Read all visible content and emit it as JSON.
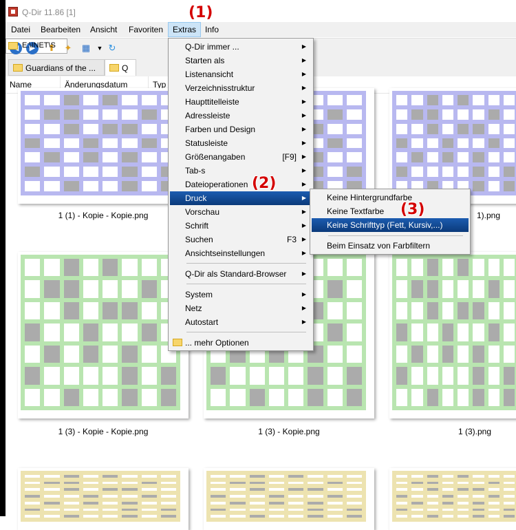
{
  "window": {
    "title": "Q-Dir 11.86 [1]"
  },
  "menubar": {
    "items": [
      "Datei",
      "Bearbeiten",
      "Ansicht",
      "Favoriten",
      "Extras",
      "Info"
    ]
  },
  "address": {
    "value": "E:\\INET\\S"
  },
  "tabs": [
    {
      "label": "Guardians of the ..."
    },
    {
      "label": "Q"
    }
  ],
  "columns": [
    "Name",
    "Änderungsdatum",
    "Typ"
  ],
  "thumbnails": [
    {
      "caption": "1 (1) - Kopie - Kopie.png",
      "color": "#b8b8f0"
    },
    {
      "caption": "1).png",
      "color": "#b8b8f0"
    },
    {
      "caption": "1 (3) - Kopie - Kopie.png",
      "color": "#b9e5b0"
    },
    {
      "caption": "1 (3) - Kopie.png",
      "color": "#b9e5b0"
    },
    {
      "caption": "1 (3).png",
      "color": "#b9e5b0"
    },
    {
      "caption": "",
      "color": "#ede3b0"
    }
  ],
  "extras_menu": {
    "items": [
      {
        "label": "Q-Dir immer ...",
        "submenu": true
      },
      {
        "label": "Starten als",
        "submenu": true
      },
      {
        "label": "Listenansicht",
        "submenu": true
      },
      {
        "label": "Verzeichnisstruktur",
        "submenu": true
      },
      {
        "label": "Haupttitelleiste",
        "submenu": true
      },
      {
        "label": "Adressleiste",
        "submenu": true
      },
      {
        "label": "Farben und Design",
        "submenu": true
      },
      {
        "label": "Statusleiste",
        "submenu": true
      },
      {
        "label": "Größenangaben",
        "shortcut": "[F9]",
        "submenu": true
      },
      {
        "label": "Tab-s",
        "submenu": true
      },
      {
        "label": "Dateioperationen",
        "submenu": true
      },
      {
        "label": "Druck",
        "submenu": true,
        "highlighted": true
      },
      {
        "label": "Vorschau",
        "submenu": true
      },
      {
        "label": "Schrift",
        "submenu": true
      },
      {
        "label": "Suchen",
        "shortcut": "F3",
        "submenu": true
      },
      {
        "label": "Ansichtseinstellungen",
        "submenu": true
      },
      {
        "label": "Q-Dir als Standard-Browser",
        "submenu": true
      },
      {
        "label": "System",
        "submenu": true
      },
      {
        "label": "Netz",
        "submenu": true
      },
      {
        "label": "Autostart",
        "submenu": true
      },
      {
        "label": "... mehr Optionen",
        "submenu": false
      }
    ]
  },
  "druck_submenu": {
    "items": [
      {
        "label": "Keine Hintergrundfarbe"
      },
      {
        "label": "Keine Textfarbe"
      },
      {
        "label": "Keine Schrifttyp (Fett, Kursiv,...)",
        "highlighted": true
      },
      {
        "label": "Beim Einsatz von Farbfiltern"
      }
    ]
  },
  "annotations": [
    "(1)",
    "(2)",
    "(3)"
  ],
  "colors": {
    "menu_highlight": "#0b3a7a",
    "annotation": "#d40000"
  }
}
